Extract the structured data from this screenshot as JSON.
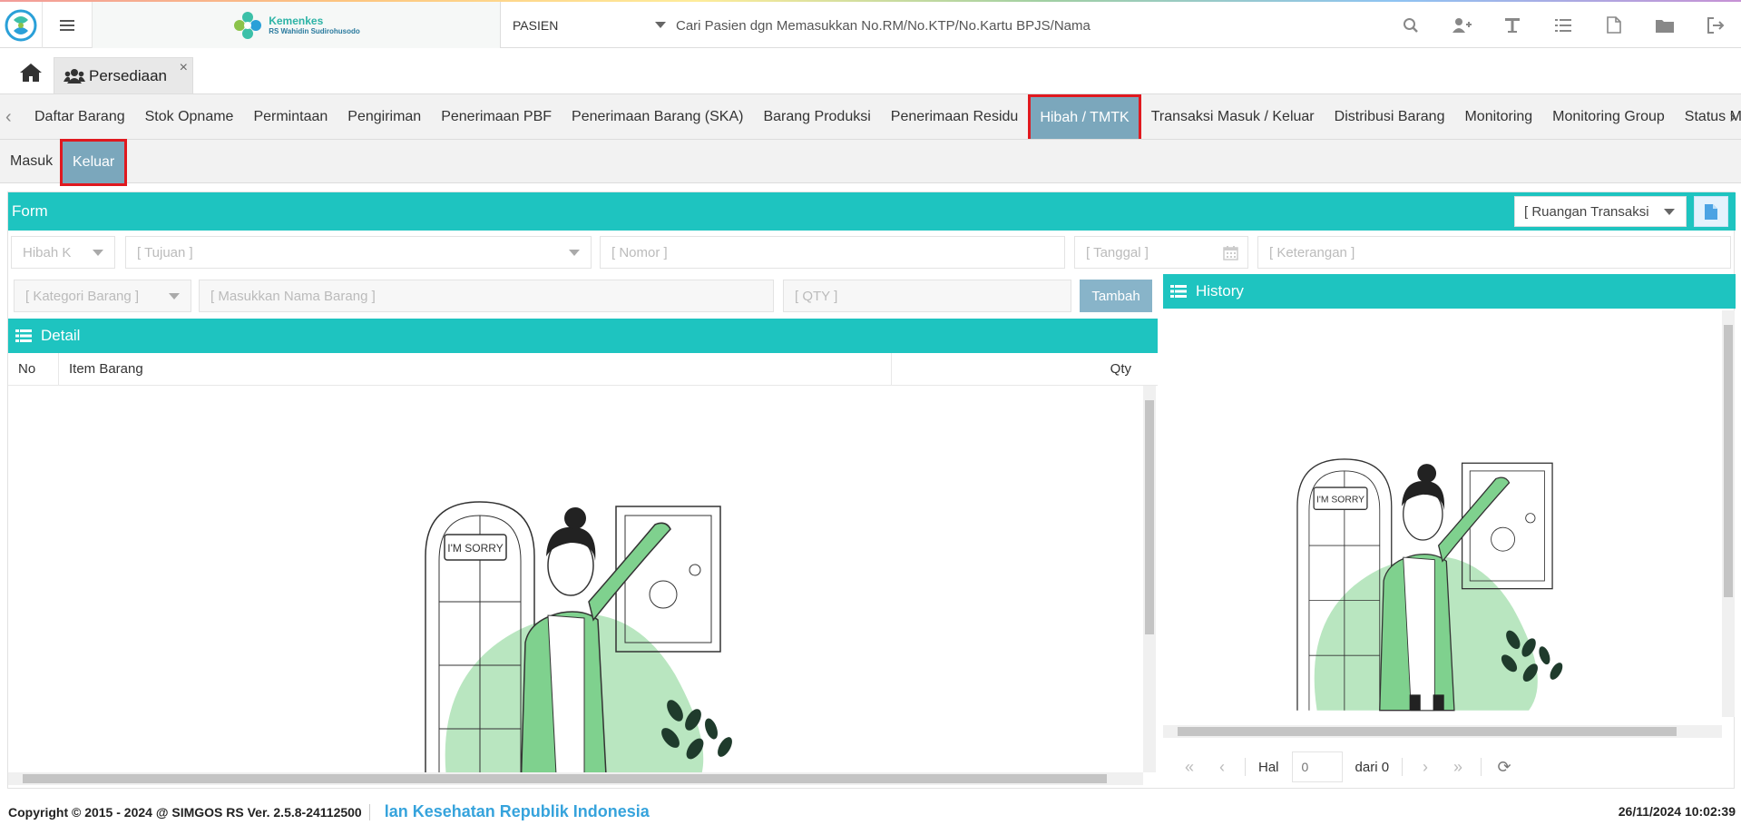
{
  "header": {
    "brand_title": "Kemenkes",
    "brand_subtitle": "RS Wahidin Sudirohusodo",
    "search_category": "PASIEN",
    "search_placeholder": "Cari Pasien dgn Memasukkan No.RM/No.KTP/No.Kartu BPJS/Nama",
    "icons": [
      "search-icon",
      "add-user-icon",
      "text-icon",
      "list-icon",
      "pdf-icon",
      "folder-icon",
      "logout-icon"
    ]
  },
  "tabs": {
    "open_tab_label": "Persediaan",
    "close_symbol": "×"
  },
  "menu": {
    "items": [
      "Daftar Barang",
      "Stok Opname",
      "Permintaan",
      "Pengiriman",
      "Penerimaan PBF",
      "Penerimaan Barang (SKA)",
      "Barang Produksi",
      "Penerimaan Residu",
      "Hibah / TMTK",
      "Transaksi Masuk / Keluar",
      "Distribusi Barang",
      "Monitoring",
      "Monitoring Group",
      "Status Mutasi B"
    ],
    "active": "Hibah / TMTK"
  },
  "subtabs": {
    "items": [
      "Masuk",
      "Keluar"
    ],
    "active": "Keluar"
  },
  "form": {
    "title": "Form",
    "ruangan_placeholder": "[ Ruangan Transaksi",
    "jenis_value": "Hibah K",
    "tujuan_placeholder": "[ Tujuan ]",
    "nomor_placeholder": "[ Nomor ]",
    "tanggal_placeholder": "[ Tanggal ]",
    "keterangan_placeholder": "[ Keterangan ]",
    "kategori_placeholder": "[ Kategori Barang ]",
    "nama_barang_placeholder": "[ Masukkan Nama Barang ]",
    "qty_placeholder": "[ QTY ]",
    "tambah_label": "Tambah"
  },
  "detail": {
    "title": "Detail",
    "columns": [
      "No",
      "Item Barang",
      "Qty"
    ],
    "empty_badge": "I'M SORRY"
  },
  "history": {
    "title": "History",
    "empty_badge": "I'M SORRY",
    "pager": {
      "hal_label": "Hal",
      "page_value": "0",
      "of_label": "dari 0"
    }
  },
  "footer": {
    "copyright": "Copyright © 2015 - 2024 @ SIMGOS RS Ver. 2.5.8-24112500",
    "marquee": "lan Kesehatan Republik Indonesia",
    "datetime": "26/11/2024 10:02:39"
  },
  "colors": {
    "teal_header": "#1ec4c0",
    "active_tab": "#7ba7bc",
    "highlight_border": "#e0191f"
  }
}
